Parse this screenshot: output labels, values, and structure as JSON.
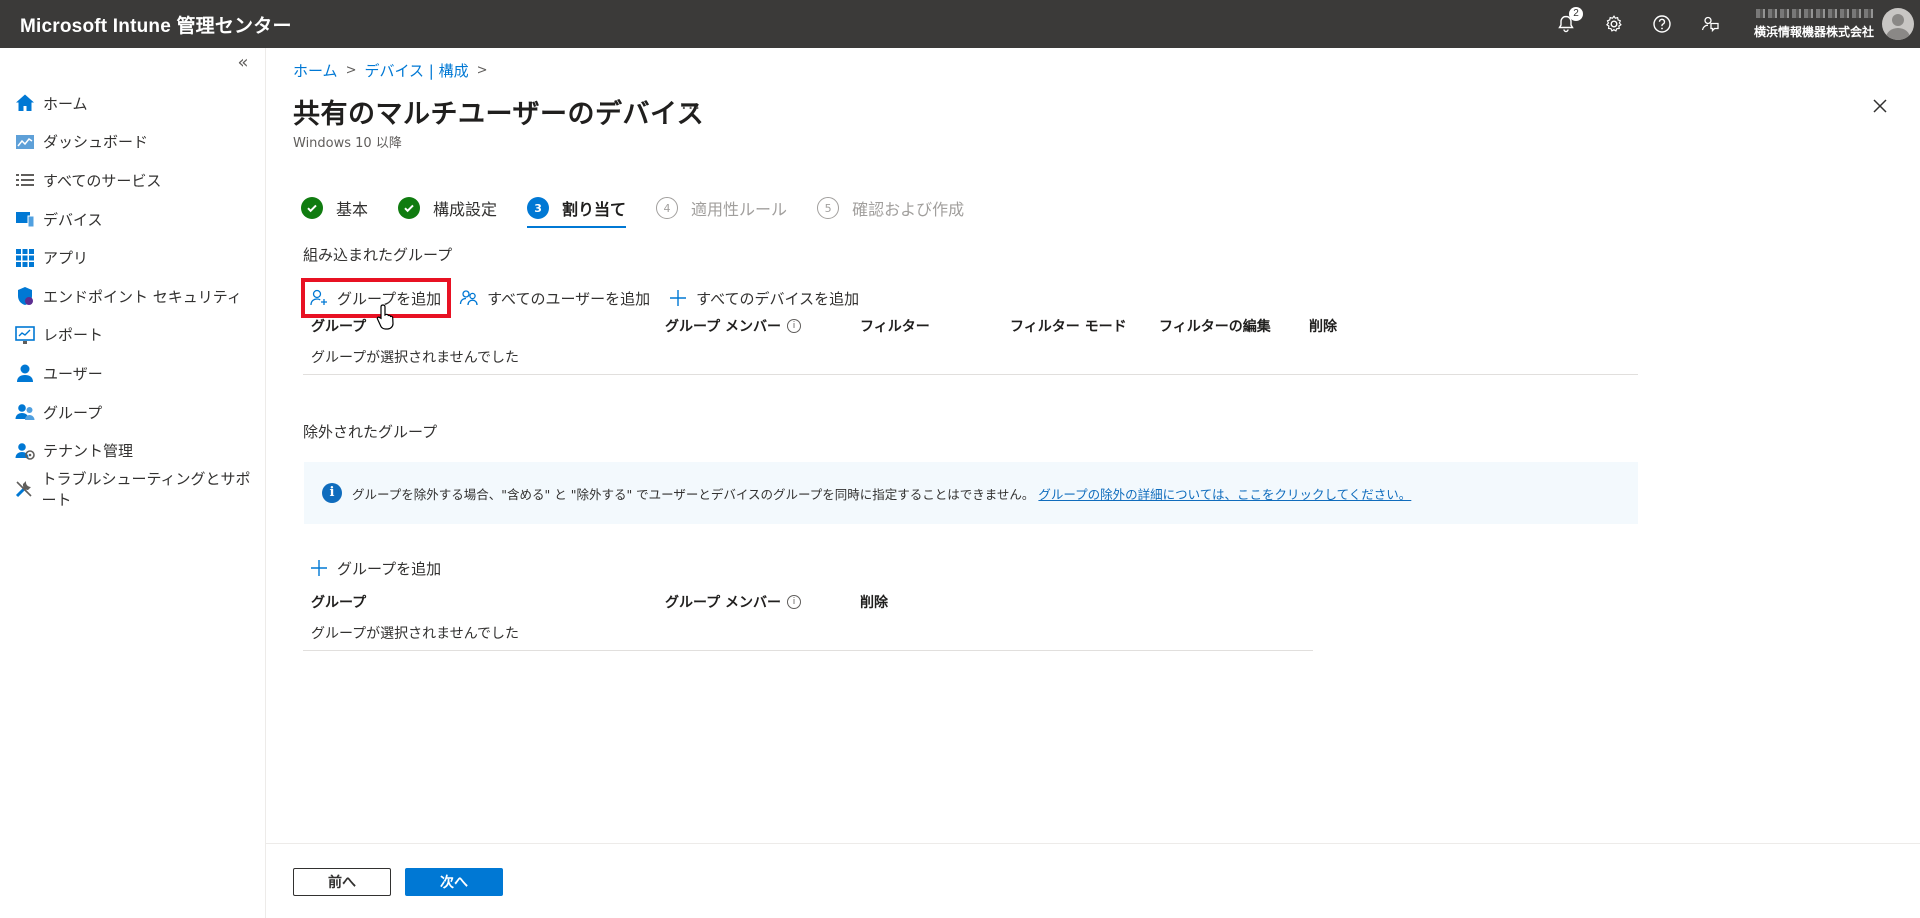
{
  "topbar": {
    "brand": "Microsoft Intune 管理センター",
    "notification_count": "2",
    "icons": [
      "bell-icon",
      "settings-gear-icon",
      "help-icon",
      "feedback-icon"
    ],
    "org_name": "横浜情報機器株式会社"
  },
  "sidebar": {
    "collapse_label": "«",
    "items": [
      {
        "label": "ホーム",
        "icon": "home-icon"
      },
      {
        "label": "ダッシュボード",
        "icon": "dashboard-icon"
      },
      {
        "label": "すべてのサービス",
        "icon": "list-icon"
      },
      {
        "label": "デバイス",
        "icon": "devices-icon"
      },
      {
        "label": "アプリ",
        "icon": "apps-grid-icon"
      },
      {
        "label": "エンドポイント セキュリティ",
        "icon": "shield-icon"
      },
      {
        "label": "レポート",
        "icon": "reports-icon"
      },
      {
        "label": "ユーザー",
        "icon": "user-icon"
      },
      {
        "label": "グループ",
        "icon": "group-icon"
      },
      {
        "label": "テナント管理",
        "icon": "tenant-admin-icon"
      },
      {
        "label": "トラブルシューティングとサポート",
        "icon": "troubleshoot-icon"
      }
    ]
  },
  "breadcrumb": [
    "ホーム",
    "デバイス | 構成"
  ],
  "page": {
    "title": "共有のマルチユーザーのデバイス",
    "more": "···",
    "subtitle": "Windows 10 以降"
  },
  "steps": [
    {
      "label": "基本",
      "state": "done",
      "num": ""
    },
    {
      "label": "構成設定",
      "state": "done",
      "num": ""
    },
    {
      "label": "割り当て",
      "state": "current",
      "num": "3"
    },
    {
      "label": "適用性ルール",
      "state": "todo",
      "num": "4"
    },
    {
      "label": "確認および作成",
      "state": "todo",
      "num": "5"
    }
  ],
  "included": {
    "heading": "組み込まれたグループ",
    "commands": {
      "add_group": "グループを追加",
      "add_all_users": "すべてのユーザーを追加",
      "add_all_devices": "すべてのデバイスを追加"
    },
    "columns": {
      "group": "グループ",
      "members": "グループ メンバー",
      "filter": "フィルター",
      "filter_mode": "フィルター モード",
      "edit_filter": "フィルターの編集",
      "delete": "削除"
    },
    "empty": "グループが選択されませんでした"
  },
  "excluded": {
    "heading": "除外されたグループ",
    "info_text": "グループを除外する場合、\"含める\" と \"除外する\" でユーザーとデバイスのグループを同時に指定することはできません。",
    "info_link": "グループの除外の詳細については、ここをクリックしてください。",
    "add_group": "グループを追加",
    "columns": {
      "group": "グループ",
      "members": "グループ メンバー",
      "delete": "削除"
    },
    "empty": "グループが選択されませんでした"
  },
  "footer": {
    "prev": "前へ",
    "next": "次へ"
  },
  "colors": {
    "topbar": "#3b3a39",
    "accent": "#0078d4",
    "success": "#107c10",
    "highlight": "#e81123"
  }
}
